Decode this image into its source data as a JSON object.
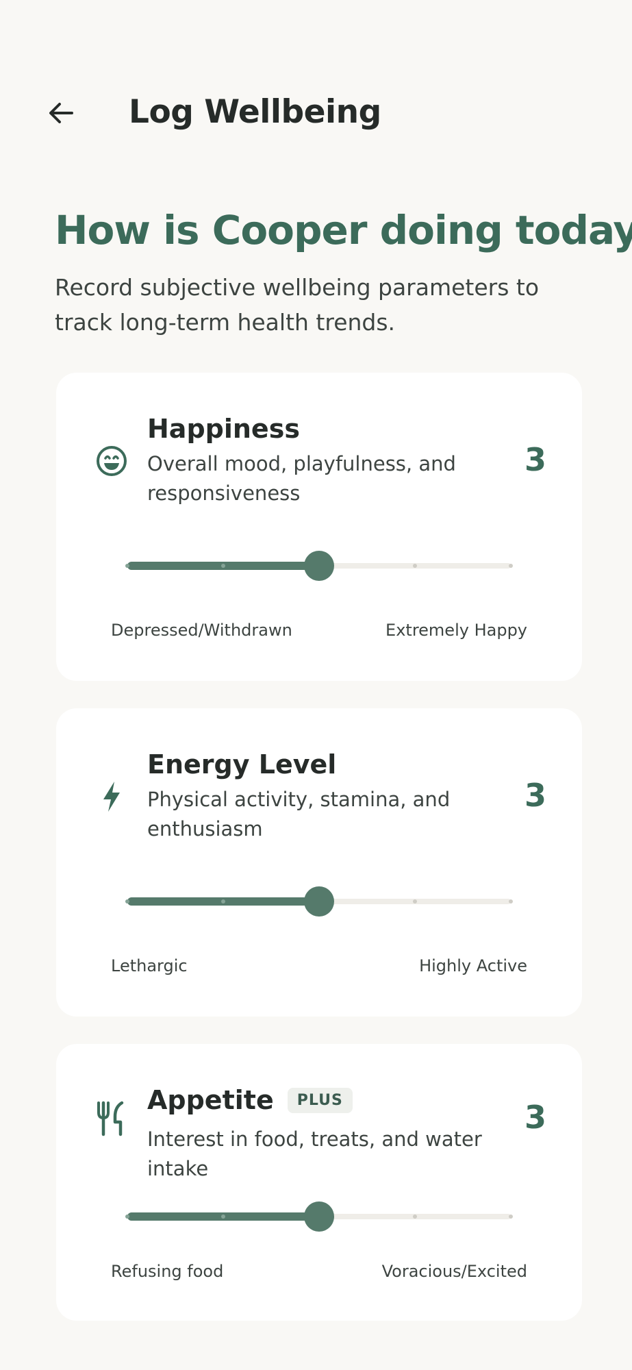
{
  "header": {
    "title": "Log Wellbeing"
  },
  "intro": {
    "headline": "How is Cooper doing today?",
    "description": "Record subjective wellbeing parameters to track long-term health trends."
  },
  "parameters": [
    {
      "title": "Happiness",
      "description": "Overall mood, playfulness, and responsiveness",
      "icon": "smiley-face-icon",
      "value": 3,
      "min": 1,
      "max": 5,
      "min_label": "Depressed/Withdrawn",
      "max_label": "Extremely Happy"
    },
    {
      "title": "Energy Level",
      "description": "Physical activity, stamina, and enthusiasm",
      "icon": "lightning-bolt-icon",
      "value": 3,
      "min": 1,
      "max": 5,
      "min_label": "Lethargic",
      "max_label": "Highly Active"
    },
    {
      "title": "Appetite",
      "badge": "PLUS",
      "description": "Interest in food, treats, and water intake",
      "icon": "fork-knife-icon",
      "value": 3,
      "min": 1,
      "max": 5,
      "min_label": "Refusing food",
      "max_label": "Voracious/Excited"
    }
  ],
  "colors": {
    "accent": "#3c6b5a",
    "slider": "#557a6b",
    "background": "#f9f8f5",
    "card": "#ffffff"
  }
}
